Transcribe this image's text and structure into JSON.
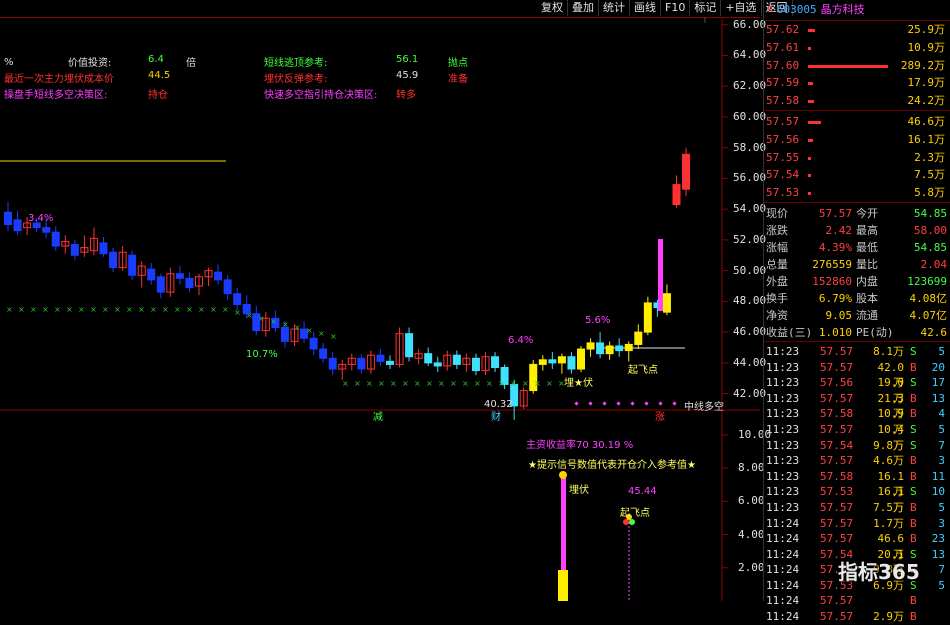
{
  "toolbar": [
    "复权",
    "叠加",
    "统计",
    "画线",
    "F10",
    "标记",
    "+自选",
    "返回"
  ],
  "stock": {
    "badge": "R",
    "code": "603005",
    "name": "晶方科技"
  },
  "info": {
    "row1": {
      "pct": "%",
      "label": "价值投资:",
      "value": "6.4",
      "unit": "倍",
      "label2": "短线逃顶参考:",
      "value2": "56.1",
      "tag2": "抛点"
    },
    "row2": {
      "label": "最近一次主力埋伏成本价",
      "value": "44.5",
      "label2": "埋伏反弹参考:",
      "value2": "45.9",
      "tag2": "准备"
    },
    "row3": {
      "label": "操盘手短线多空决策区:",
      "tag": "持仓",
      "label2": "快速多空指引持仓决策区:",
      "tag2": "转多"
    }
  },
  "main_axis": [
    "66.00",
    "64.00",
    "62.00",
    "60.00",
    "58.00",
    "56.00",
    "54.00",
    "52.00",
    "50.00",
    "48.00",
    "46.00",
    "44.00",
    "42.00"
  ],
  "sub_axis": [
    "10.00",
    "8.00",
    "6.00",
    "4.00",
    "2.00"
  ],
  "annotations": {
    "pct_a": "3.4%",
    "pct_b": "10.7%",
    "pct_c": "6.4%",
    "pct_d": "5.6%",
    "low_price": "40.32",
    "jian": "减",
    "cai": "财",
    "zhang": "涨",
    "mai_fu": "埋★伏",
    "qi_fei": "起飞点",
    "zhong_xian": "中线多空",
    "sub_line1": "主资收益率70  30.19    %",
    "sub_line2": "★提示信号数值代表开仓介入参考值★",
    "sub_maifu": "埋伏",
    "sub_val": "45.44",
    "sub_qifei": "起飞点"
  },
  "orderbook_asks": [
    {
      "price": "57.62",
      "vol": "25.9万",
      "bar": 0.09
    },
    {
      "price": "57.61",
      "vol": "10.9万",
      "bar": 0.04
    },
    {
      "price": "57.60",
      "vol": "289.2万",
      "bar": 1.0
    },
    {
      "price": "57.59",
      "vol": "17.9万",
      "bar": 0.06
    },
    {
      "price": "57.58",
      "vol": "24.2万",
      "bar": 0.08
    }
  ],
  "orderbook_bids": [
    {
      "price": "57.57",
      "vol": "46.6万",
      "bar": 0.16
    },
    {
      "price": "57.56",
      "vol": "16.1万",
      "bar": 0.06
    },
    {
      "price": "57.55",
      "vol": "2.3万",
      "bar": 0.01
    },
    {
      "price": "57.54",
      "vol": "7.5万",
      "bar": 0.03
    },
    {
      "price": "57.53",
      "vol": "5.8万",
      "bar": 0.02
    }
  ],
  "quote": [
    {
      "l": "现价",
      "lv": "57.57",
      "lc": "#ff4040",
      "r": "今开",
      "rv": "54.85",
      "rc": "#40ff40"
    },
    {
      "l": "涨跌",
      "lv": "2.42",
      "lc": "#ff4040",
      "r": "最高",
      "rv": "58.00",
      "rc": "#ff4040"
    },
    {
      "l": "涨幅",
      "lv": "4.39%",
      "lc": "#ff4040",
      "r": "最低",
      "rv": "54.85",
      "rc": "#40ff40"
    },
    {
      "l": "总量",
      "lv": "276559",
      "lc": "#ffd000",
      "r": "量比",
      "rv": "2.04",
      "rc": "#ff4040"
    },
    {
      "l": "外盘",
      "lv": "152860",
      "lc": "#ff4040",
      "r": "内盘",
      "rv": "123699",
      "rc": "#40ff40"
    },
    {
      "l": "换手",
      "lv": "6.79%",
      "lc": "#ffd000",
      "r": "股本",
      "rv": "4.08亿",
      "rc": "#ffd000"
    },
    {
      "l": "净资",
      "lv": "9.05",
      "lc": "#ffd000",
      "r": "流通",
      "rv": "4.07亿",
      "rc": "#ffd000"
    },
    {
      "l": "收益(三)",
      "lv": "1.010",
      "lc": "#ffd000",
      "r": "PE(动)",
      "rv": "42.6",
      "rc": "#ffd000"
    }
  ],
  "ticks": [
    {
      "t": "11:23",
      "p": "57.57",
      "v": "8.1万",
      "s": "S",
      "n": "5"
    },
    {
      "t": "11:23",
      "p": "57.57",
      "v": "42.0万",
      "s": "B",
      "n": "20"
    },
    {
      "t": "11:23",
      "p": "57.56",
      "v": "19.0万",
      "s": "S",
      "n": "17"
    },
    {
      "t": "11:23",
      "p": "57.57",
      "v": "21.3万",
      "s": "B",
      "n": "13"
    },
    {
      "t": "11:23",
      "p": "57.58",
      "v": "10.9万",
      "s": "B",
      "n": "4"
    },
    {
      "t": "11:23",
      "p": "57.57",
      "v": "10.4万",
      "s": "S",
      "n": "5"
    },
    {
      "t": "11:23",
      "p": "57.54",
      "v": "9.8万",
      "s": "S",
      "n": "7"
    },
    {
      "t": "11:23",
      "p": "57.57",
      "v": "4.6万",
      "s": "B",
      "n": "3"
    },
    {
      "t": "11:23",
      "p": "57.58",
      "v": "16.1万",
      "s": "B",
      "n": "11"
    },
    {
      "t": "11:23",
      "p": "57.53",
      "v": "16.1万",
      "s": "S",
      "n": "10"
    },
    {
      "t": "11:23",
      "p": "57.57",
      "v": "7.5万",
      "s": "B",
      "n": "5"
    },
    {
      "t": "11:24",
      "p": "57.57",
      "v": "1.7万",
      "s": "B",
      "n": "3"
    },
    {
      "t": "11:24",
      "p": "57.57",
      "v": "46.6万",
      "s": "B",
      "n": "23"
    },
    {
      "t": "11:24",
      "p": "57.54",
      "v": "20.1万",
      "s": "S",
      "n": "13"
    },
    {
      "t": "11:24",
      "p": "57.57",
      "v": "9.8万",
      "s": "B",
      "n": "7"
    },
    {
      "t": "11:24",
      "p": "57.53",
      "v": "6.9万",
      "s": "S",
      "n": "5"
    },
    {
      "t": "11:24",
      "p": "57.57",
      "v": "",
      "s": "B",
      "n": ""
    },
    {
      "t": "11:24",
      "p": "57.57",
      "v": "2.9万",
      "s": "B",
      "n": ""
    }
  ],
  "watermark": "指标365",
  "chart_data": {
    "type": "candlestick",
    "ylim": [
      41,
      66.5
    ],
    "candles": [
      [
        53.8,
        54.5,
        52.6,
        53.0
      ],
      [
        53.3,
        53.9,
        52.3,
        52.6
      ],
      [
        52.8,
        53.5,
        52.3,
        53.1
      ],
      [
        53.1,
        53.4,
        52.5,
        52.8
      ],
      [
        52.8,
        53.4,
        52.1,
        52.5
      ],
      [
        52.5,
        52.9,
        51.3,
        51.6
      ],
      [
        51.6,
        52.3,
        51.1,
        51.9
      ],
      [
        51.7,
        52.0,
        50.7,
        51.0
      ],
      [
        51.2,
        52.3,
        50.9,
        51.5
      ],
      [
        51.3,
        52.8,
        51.0,
        52.1
      ],
      [
        51.8,
        52.2,
        50.9,
        51.1
      ],
      [
        51.2,
        51.5,
        49.9,
        50.2
      ],
      [
        50.2,
        51.6,
        50.0,
        51.2
      ],
      [
        51.0,
        51.3,
        49.4,
        49.7
      ],
      [
        49.7,
        50.6,
        48.9,
        50.3
      ],
      [
        50.1,
        50.5,
        49.1,
        49.4
      ],
      [
        49.6,
        49.8,
        48.2,
        48.6
      ],
      [
        48.6,
        50.2,
        48.3,
        49.8
      ],
      [
        49.8,
        50.3,
        49.1,
        49.5
      ],
      [
        49.5,
        49.9,
        48.6,
        48.9
      ],
      [
        49.0,
        49.8,
        48.4,
        49.6
      ],
      [
        49.6,
        50.2,
        49.0,
        50.0
      ],
      [
        49.9,
        50.4,
        49.1,
        49.4
      ],
      [
        49.4,
        49.7,
        48.1,
        48.5
      ],
      [
        48.5,
        48.9,
        47.4,
        47.8
      ],
      [
        47.8,
        48.4,
        46.9,
        47.2
      ],
      [
        47.2,
        47.7,
        45.8,
        46.1
      ],
      [
        46.1,
        47.3,
        45.7,
        46.9
      ],
      [
        46.9,
        47.4,
        46.0,
        46.3
      ],
      [
        46.3,
        46.7,
        45.0,
        45.4
      ],
      [
        45.4,
        46.5,
        45.1,
        46.2
      ],
      [
        46.2,
        46.7,
        45.3,
        45.6
      ],
      [
        45.6,
        46.0,
        44.5,
        44.9
      ],
      [
        44.9,
        45.3,
        44.0,
        44.3
      ],
      [
        44.3,
        44.7,
        43.2,
        43.6
      ],
      [
        43.6,
        44.2,
        42.9,
        43.9
      ],
      [
        43.9,
        44.6,
        43.5,
        44.3
      ],
      [
        44.3,
        44.6,
        43.3,
        43.6
      ],
      [
        43.6,
        44.8,
        43.3,
        44.5
      ],
      [
        44.5,
        44.9,
        43.8,
        44.1
      ],
      [
        44.1,
        44.5,
        43.6,
        43.9
      ],
      [
        43.9,
        46.3,
        43.7,
        45.9
      ],
      [
        45.9,
        46.3,
        44.1,
        44.4
      ],
      [
        44.3,
        44.9,
        43.9,
        44.6
      ],
      [
        44.6,
        45.0,
        43.8,
        44.0
      ],
      [
        44.0,
        44.4,
        43.4,
        43.8
      ],
      [
        43.8,
        44.8,
        43.5,
        44.5
      ],
      [
        44.5,
        44.8,
        43.6,
        43.9
      ],
      [
        43.9,
        44.6,
        43.4,
        44.3
      ],
      [
        44.3,
        44.6,
        43.2,
        43.5
      ],
      [
        43.5,
        44.7,
        43.2,
        44.4
      ],
      [
        44.4,
        44.7,
        43.4,
        43.7
      ],
      [
        43.7,
        43.9,
        42.3,
        42.6
      ],
      [
        42.6,
        42.9,
        40.3,
        41.2
      ],
      [
        41.2,
        42.4,
        41.0,
        42.2
      ],
      [
        42.2,
        44.2,
        42.0,
        43.9
      ],
      [
        43.9,
        44.5,
        43.5,
        44.2
      ],
      [
        44.2,
        44.7,
        43.6,
        44.0
      ],
      [
        44.0,
        44.6,
        43.3,
        44.4
      ],
      [
        44.4,
        44.7,
        43.3,
        43.6
      ],
      [
        43.6,
        45.1,
        43.4,
        44.9
      ],
      [
        44.9,
        45.6,
        44.4,
        45.3
      ],
      [
        45.3,
        46.0,
        44.3,
        44.6
      ],
      [
        44.6,
        45.4,
        44.2,
        45.1
      ],
      [
        45.1,
        45.6,
        44.4,
        44.8
      ],
      [
        44.8,
        45.4,
        44.1,
        45.2
      ],
      [
        45.2,
        46.5,
        44.9,
        46.0
      ],
      [
        46.0,
        48.3,
        45.8,
        47.9
      ],
      [
        47.9,
        48.1,
        47.0,
        47.6
      ],
      [
        47.3,
        49.1,
        47.1,
        48.5
      ],
      [
        54.3,
        56.2,
        54.1,
        55.6
      ],
      [
        55.3,
        58.0,
        54.85,
        57.57
      ]
    ]
  }
}
